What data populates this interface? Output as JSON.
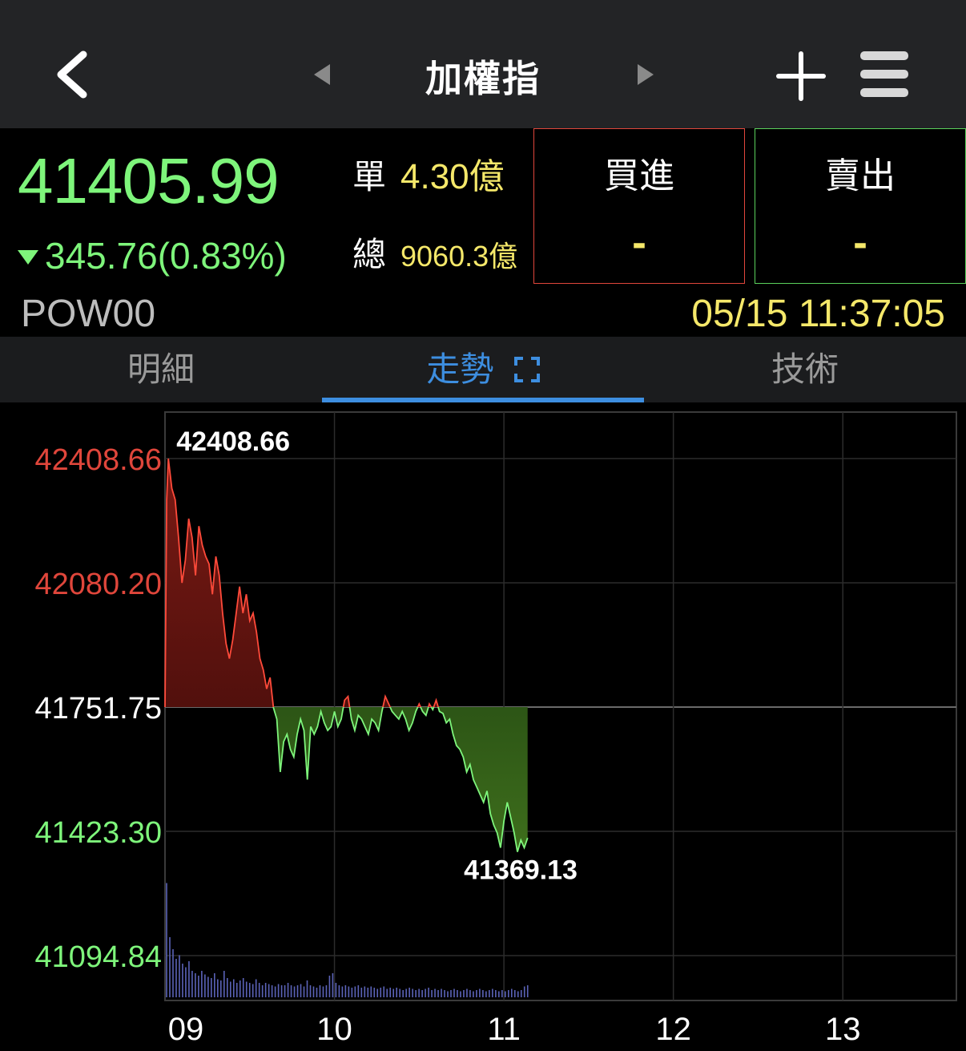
{
  "header": {
    "title": "加權指",
    "back_icon": "back-chevron-icon",
    "prev_icon": "prev-triangle-icon",
    "next_icon": "next-triangle-icon",
    "add_icon": "plus-icon",
    "menu_icon": "hamburger-menu-icon"
  },
  "quote": {
    "price": "41405.99",
    "change": "345.76",
    "change_pct": "(0.83%)",
    "direction": "down",
    "single_volume_label": "單",
    "single_volume_value": "4.30億",
    "total_volume_label": "總",
    "total_volume_value": "9060.3億",
    "buy_label": "買進",
    "buy_value": "-",
    "sell_label": "賣出",
    "sell_value": "-",
    "code": "POW00",
    "timestamp": "05/15 11:37:05"
  },
  "tabs": [
    {
      "label": "明細",
      "active": false
    },
    {
      "label": "走勢",
      "active": true
    },
    {
      "label": "技術",
      "active": false
    }
  ],
  "colors": {
    "up": "#e0463b",
    "down": "#7ef57b",
    "accent": "#3d8ee0",
    "highlight": "#f5e86a"
  },
  "chart_data": {
    "type": "area",
    "y_ticks": [
      {
        "label": "42408.66",
        "value": 42408.66,
        "tone": "up"
      },
      {
        "label": "42080.20",
        "value": 42080.2,
        "tone": "up"
      },
      {
        "label": "41751.75",
        "value": 41751.75,
        "tone": "ref"
      },
      {
        "label": "41423.30",
        "value": 41423.3,
        "tone": "down"
      },
      {
        "label": "41094.84",
        "value": 41094.84,
        "tone": "down"
      }
    ],
    "x_ticks": [
      "09",
      "10",
      "11",
      "12",
      "13"
    ],
    "ylim": [
      41094.84,
      42408.66
    ],
    "reference": 41751.75,
    "high_label": "42408.66",
    "low_label": "41369.13",
    "x_range_hours": [
      9,
      13.5
    ],
    "grid": true,
    "series": [
      {
        "points": [
          [
            9.0,
            41751.75
          ],
          [
            9.01,
            42300
          ],
          [
            9.02,
            42408.66
          ],
          [
            9.04,
            42330
          ],
          [
            9.06,
            42300
          ],
          [
            9.08,
            42200
          ],
          [
            9.1,
            42080
          ],
          [
            9.12,
            42140
          ],
          [
            9.14,
            42250
          ],
          [
            9.16,
            42200
          ],
          [
            9.18,
            42100
          ],
          [
            9.2,
            42230
          ],
          [
            9.22,
            42180
          ],
          [
            9.24,
            42150
          ],
          [
            9.26,
            42130
          ],
          [
            9.28,
            42050
          ],
          [
            9.3,
            42150
          ],
          [
            9.32,
            42100
          ],
          [
            9.34,
            42000
          ],
          [
            9.36,
            41920
          ],
          [
            9.38,
            41880
          ],
          [
            9.4,
            41930
          ],
          [
            9.42,
            42000
          ],
          [
            9.44,
            42070
          ],
          [
            9.46,
            42000
          ],
          [
            9.48,
            42050
          ],
          [
            9.5,
            41980
          ],
          [
            9.52,
            42000
          ],
          [
            9.54,
            41950
          ],
          [
            9.56,
            41880
          ],
          [
            9.58,
            41850
          ],
          [
            9.6,
            41800
          ],
          [
            9.62,
            41830
          ],
          [
            9.64,
            41750
          ],
          [
            9.66,
            41720
          ],
          [
            9.68,
            41580
          ],
          [
            9.7,
            41660
          ],
          [
            9.72,
            41680
          ],
          [
            9.74,
            41640
          ],
          [
            9.76,
            41620
          ],
          [
            9.78,
            41680
          ],
          [
            9.8,
            41720
          ],
          [
            9.82,
            41690
          ],
          [
            9.84,
            41560
          ],
          [
            9.86,
            41700
          ],
          [
            9.88,
            41680
          ],
          [
            9.9,
            41700
          ],
          [
            9.92,
            41740
          ],
          [
            9.94,
            41710
          ],
          [
            9.96,
            41690
          ],
          [
            9.98,
            41700
          ],
          [
            10.0,
            41740
          ],
          [
            10.02,
            41700
          ],
          [
            10.04,
            41720
          ],
          [
            10.06,
            41770
          ],
          [
            10.08,
            41780
          ],
          [
            10.1,
            41720
          ],
          [
            10.12,
            41690
          ],
          [
            10.14,
            41730
          ],
          [
            10.16,
            41720
          ],
          [
            10.18,
            41700
          ],
          [
            10.2,
            41680
          ],
          [
            10.22,
            41720
          ],
          [
            10.24,
            41710
          ],
          [
            10.26,
            41690
          ],
          [
            10.28,
            41740
          ],
          [
            10.3,
            41780
          ],
          [
            10.32,
            41760
          ],
          [
            10.34,
            41740
          ],
          [
            10.36,
            41730
          ],
          [
            10.38,
            41720
          ],
          [
            10.4,
            41740
          ],
          [
            10.42,
            41720
          ],
          [
            10.44,
            41690
          ],
          [
            10.46,
            41710
          ],
          [
            10.48,
            41740
          ],
          [
            10.5,
            41760
          ],
          [
            10.52,
            41740
          ],
          [
            10.54,
            41730
          ],
          [
            10.56,
            41760
          ],
          [
            10.58,
            41745
          ],
          [
            10.6,
            41770
          ],
          [
            10.62,
            41740
          ],
          [
            10.64,
            41735
          ],
          [
            10.66,
            41710
          ],
          [
            10.68,
            41720
          ],
          [
            10.7,
            41680
          ],
          [
            10.72,
            41650
          ],
          [
            10.74,
            41640
          ],
          [
            10.76,
            41620
          ],
          [
            10.78,
            41580
          ],
          [
            10.8,
            41600
          ],
          [
            10.82,
            41560
          ],
          [
            10.84,
            41540
          ],
          [
            10.86,
            41520
          ],
          [
            10.88,
            41500
          ],
          [
            10.9,
            41530
          ],
          [
            10.92,
            41470
          ],
          [
            10.94,
            41440
          ],
          [
            10.96,
            41420
          ],
          [
            10.98,
            41380
          ],
          [
            11.0,
            41450
          ],
          [
            11.02,
            41500
          ],
          [
            11.04,
            41460
          ],
          [
            11.06,
            41420
          ],
          [
            11.08,
            41369.13
          ],
          [
            11.1,
            41400
          ],
          [
            11.12,
            41380
          ],
          [
            11.14,
            41405.99
          ]
        ]
      }
    ],
    "volume": [
      0.95,
      0.5,
      0.4,
      0.32,
      0.35,
      0.28,
      0.25,
      0.3,
      0.22,
      0.2,
      0.18,
      0.22,
      0.19,
      0.17,
      0.16,
      0.2,
      0.15,
      0.14,
      0.22,
      0.16,
      0.13,
      0.15,
      0.12,
      0.14,
      0.16,
      0.13,
      0.12,
      0.11,
      0.15,
      0.12,
      0.1,
      0.12,
      0.11,
      0.1,
      0.09,
      0.11,
      0.1,
      0.1,
      0.12,
      0.1,
      0.09,
      0.1,
      0.11,
      0.09,
      0.14,
      0.1,
      0.09,
      0.08,
      0.1,
      0.09,
      0.1,
      0.18,
      0.2,
      0.12,
      0.1,
      0.09,
      0.1,
      0.09,
      0.08,
      0.09,
      0.1,
      0.08,
      0.09,
      0.08,
      0.09,
      0.08,
      0.07,
      0.08,
      0.09,
      0.07,
      0.08,
      0.07,
      0.08,
      0.07,
      0.06,
      0.07,
      0.08,
      0.07,
      0.06,
      0.07,
      0.06,
      0.07,
      0.08,
      0.06,
      0.07,
      0.06,
      0.07,
      0.06,
      0.05,
      0.06,
      0.07,
      0.06,
      0.05,
      0.06,
      0.07,
      0.06,
      0.05,
      0.06,
      0.07,
      0.06,
      0.05,
      0.06,
      0.07,
      0.06,
      0.05,
      0.06,
      0.05,
      0.06,
      0.07,
      0.06,
      0.05,
      0.06,
      0.09,
      0.1
    ]
  }
}
